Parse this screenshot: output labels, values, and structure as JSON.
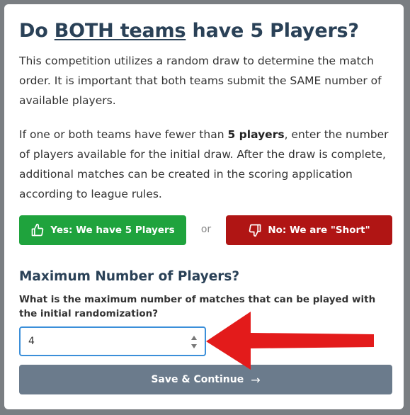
{
  "modal": {
    "title_prefix": "Do ",
    "title_underlined": "BOTH teams",
    "title_suffix": " have 5 Players?",
    "paragraph1": "This competition utilizes a random draw to determine the match order. It is important that both teams submit the SAME number of available players.",
    "paragraph2_before": "If one or both teams have fewer than ",
    "paragraph2_bold": "5 players",
    "paragraph2_after": ", enter the number of players available for the initial draw. After the draw is complete, additional matches can be created in the scoring application according to league rules.",
    "yes_button": "Yes: We have 5 Players",
    "or_label": "or",
    "no_button": "No: We are \"Short\"",
    "subtitle": "Maximum Number of Players?",
    "question": "What is the maximum number of matches that can be played with the initial randomization?",
    "max_players_value": "4",
    "save_button": "Save & Continue",
    "save_arrow": "→"
  },
  "colors": {
    "title": "#2a4157",
    "yes": "#1fa33d",
    "no": "#b01514",
    "save": "#6b7b8c",
    "input_focus": "#3b8fd9",
    "annotation_arrow": "#e31b1b"
  },
  "icons": {
    "yes": "thumbs-up-icon",
    "no": "thumbs-down-icon",
    "spinner": "number-spinner-icon",
    "annotation": "red-arrow-annotation"
  }
}
